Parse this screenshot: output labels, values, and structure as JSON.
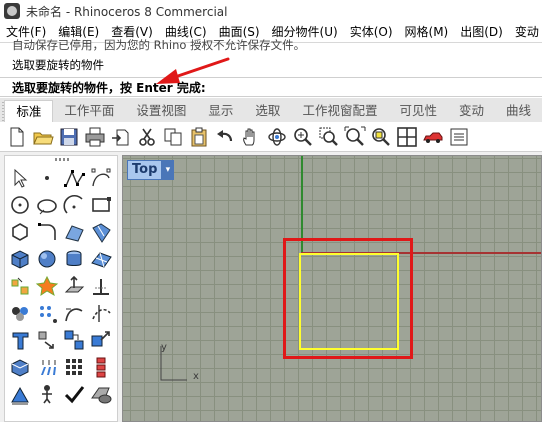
{
  "window": {
    "title": "未命名 - Rhinoceros 8 Commercial"
  },
  "menu": [
    "文件(F)",
    "编辑(E)",
    "查看(V)",
    "曲线(C)",
    "曲面(S)",
    "细分物件(U)",
    "实体(O)",
    "网格(M)",
    "出图(D)",
    "变动"
  ],
  "command_history": [
    "自动保存已停用，因为您的 Rhino 授权不允许保存文件。",
    "选取要旋转的物件"
  ],
  "command_prompt": "选取要旋转的物件，按 Enter 完成:",
  "tabs": [
    "标准",
    "工作平面",
    "设置视图",
    "显示",
    "选取",
    "工作视窗配置",
    "可见性",
    "变动",
    "曲线"
  ],
  "active_tab": "标准",
  "toolbar_icons": [
    "new-file-icon",
    "open-folder-icon",
    "save-icon",
    "print-icon",
    "import-icon",
    "cut-icon",
    "copy-icon",
    "paste-icon",
    "undo-icon",
    "pan-hand-icon",
    "rotate-view-icon",
    "zoom-dynamic-icon",
    "zoom-window-icon",
    "zoom-extents-icon",
    "zoom-selected-icon",
    "four-viewports-icon",
    "car-render-icon",
    "properties-icon"
  ],
  "sidebar_icons": [
    "select-arrow-icon",
    "point-icon",
    "polyline-icon",
    "curve-control-point-icon",
    "circle-icon",
    "ellipse-icon",
    "arc-icon",
    "rectangle-icon",
    "polygon-icon",
    "fillet-curve-icon",
    "surface-from-points-icon",
    "loft-surface-icon",
    "box-solid-icon",
    "sphere-solid-icon",
    "cylinder-solid-icon",
    "mesh-plane-icon",
    "explode-icon",
    "boolean-icon",
    "extrude-icon",
    "offset-icon",
    "group-icon",
    "array-icon",
    "blend-curve-icon",
    "trim-icon",
    "text-icon",
    "move-icon",
    "copy-objects-icon",
    "scale-icon",
    "render-preview-icon",
    "lights-icon",
    "grid-array-icon",
    "layer-icon",
    "dimension-icon",
    "gumball-icon",
    "check-icon",
    "shade-icon"
  ],
  "viewport": {
    "name": "Top",
    "dropdown_glyph": "▾",
    "axis_y_label": "y",
    "axis_x_label": "x"
  },
  "colors": {
    "grid_bg": "#9ea497",
    "axis_x": "#a63333",
    "axis_y": "#2f8a2f",
    "selection_yellow": "#ffff2e",
    "highlight_red": "#e01818",
    "viewport_tab": "#a9c7ee"
  }
}
